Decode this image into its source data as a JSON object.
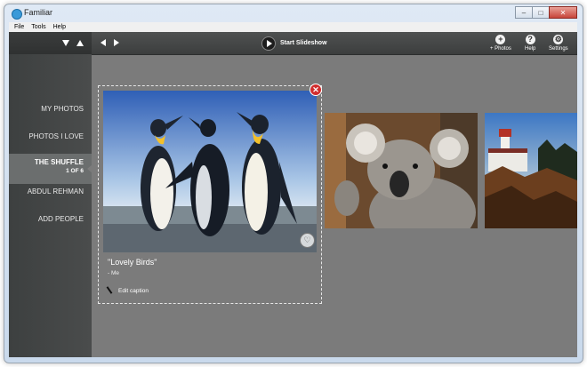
{
  "window": {
    "title": "Familiar",
    "controls": [
      "–",
      "□",
      "✕"
    ]
  },
  "menu": {
    "items": [
      "File",
      "Tools",
      "Help"
    ]
  },
  "toolbar": {
    "slideshow_label": "Start Slideshow",
    "tools": [
      {
        "icon": "plus-icon",
        "glyph": "+",
        "label": "+ Photos"
      },
      {
        "icon": "help-icon",
        "glyph": "?",
        "label": "Help"
      },
      {
        "icon": "gear-icon",
        "glyph": "⚙",
        "label": "Settings"
      }
    ]
  },
  "sidebar": {
    "items": [
      {
        "label": "MY PHOTOS"
      },
      {
        "label": "PHOTOS I LOVE"
      },
      {
        "label": "THE SHUFFLE",
        "count": "1 OF 6",
        "active": true
      },
      {
        "label": "ABDUL REHMAN"
      },
      {
        "label": "ADD PEOPLE"
      }
    ]
  },
  "current_photo": {
    "caption": "\"Lovely Birds\"",
    "author": "- Me",
    "edit_label": "Edit caption",
    "remove_glyph": "✕",
    "love_glyph": "♡"
  },
  "colors": {
    "sidebar": "#464848",
    "stage": "#7b7b7b",
    "remove": "#d12d2d"
  }
}
